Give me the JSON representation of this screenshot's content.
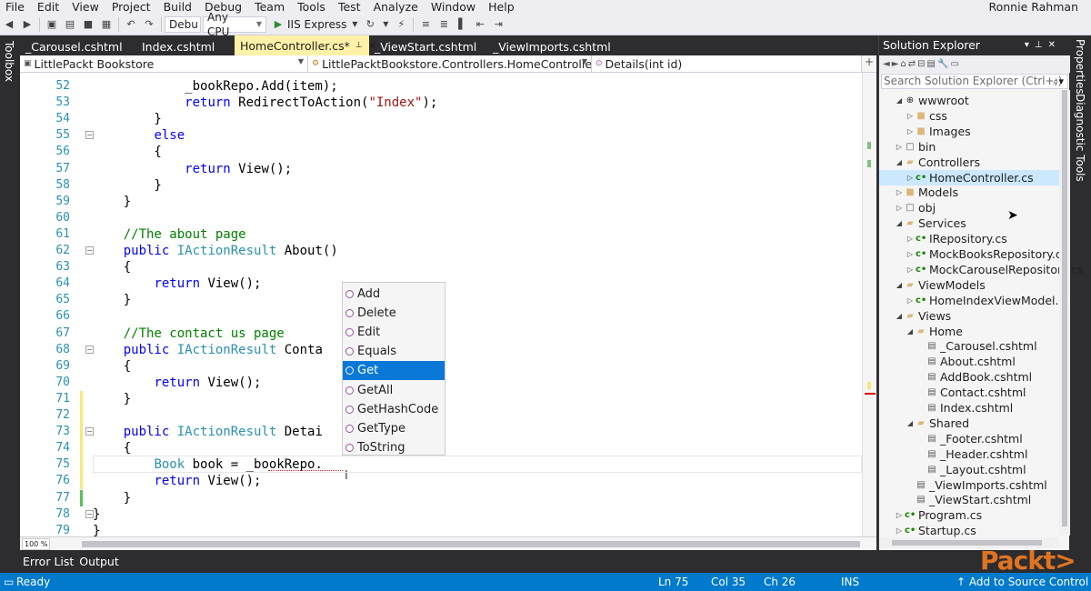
{
  "menu": [
    "File",
    "Edit",
    "View",
    "Project",
    "Build",
    "Debug",
    "Team",
    "Tools",
    "Test",
    "Analyze",
    "Window",
    "Help"
  ],
  "user": "Ronnie Rahman",
  "toolbar": {
    "config": "Debu",
    "platform": "Any CPU",
    "run_target": "IIS Express",
    "icons": [
      "back-icon",
      "forward-icon",
      "new-project-icon",
      "open-icon",
      "save-icon",
      "save-all-icon",
      "undo-icon",
      "redo-icon",
      "play-icon",
      "refresh-icon",
      "browser-link-icon",
      "comment-icon",
      "uncomment-icon",
      "bookmark-icon"
    ]
  },
  "side": {
    "toolbox": "Toolbox",
    "properties": "Properties",
    "diagnostic_tools": "Diagnostic Tools"
  },
  "doc_tabs": [
    {
      "label": "_Carousel.cshtml",
      "active": false
    },
    {
      "label": "Index.cshtml",
      "active": false
    },
    {
      "label": "HomeController.cs*",
      "active": true
    },
    {
      "label": "_ViewStart.cshtml",
      "active": false
    },
    {
      "label": "_ViewImports.cshtml",
      "active": false
    }
  ],
  "navbar": {
    "project": "LittlePackt Bookstore",
    "class": "LittlePacktBookstore.Controllers.HomeController",
    "member": "Details(int id)"
  },
  "code_lines": [
    {
      "n": "52",
      "html": "            _bookRepo.Add(item);"
    },
    {
      "n": "53",
      "html": "            return RedirectToAction(\"Index\");"
    },
    {
      "n": "54",
      "html": "        }"
    },
    {
      "n": "55",
      "html": "        else"
    },
    {
      "n": "56",
      "html": "        {"
    },
    {
      "n": "57",
      "html": "            return View();"
    },
    {
      "n": "58",
      "html": "        }"
    },
    {
      "n": "59",
      "html": "    }"
    },
    {
      "n": "60",
      "html": ""
    },
    {
      "n": "61",
      "html": "    //The about page"
    },
    {
      "n": "62",
      "html": "    public IActionResult About()"
    },
    {
      "n": "63",
      "html": "    {"
    },
    {
      "n": "64",
      "html": "        return View();"
    },
    {
      "n": "65",
      "html": "    }"
    },
    {
      "n": "66",
      "html": ""
    },
    {
      "n": "67",
      "html": "    //The contact us page"
    },
    {
      "n": "68",
      "html": "    public IActionResult Conta"
    },
    {
      "n": "69",
      "html": "    {"
    },
    {
      "n": "70",
      "html": "        return View();"
    },
    {
      "n": "71",
      "html": "    }"
    },
    {
      "n": "72",
      "html": ""
    },
    {
      "n": "73",
      "html": "    public IActionResult Detai"
    },
    {
      "n": "74",
      "html": "    {"
    },
    {
      "n": "75",
      "html": "        Book book = _bookRepo."
    },
    {
      "n": "76",
      "html": "        return View();"
    },
    {
      "n": "77",
      "html": "    }"
    },
    {
      "n": "78",
      "html": "}"
    },
    {
      "n": "79",
      "html": "}"
    }
  ],
  "intellisense": [
    "Add",
    "Delete",
    "Edit",
    "Equals",
    "Get",
    "GetAll",
    "GetHashCode",
    "GetType",
    "ToString"
  ],
  "intellisense_selected": "Get",
  "zoom": "100 %",
  "output_tabs": [
    "Error List",
    "Output"
  ],
  "solution_explorer": {
    "title": "Solution Explorer",
    "search_placeholder": "Search Solution Explorer (Ctrl+;)",
    "nodes": [
      {
        "label": "wwwroot",
        "depth": 0,
        "icon": "globe-icon",
        "arrow": "expanded"
      },
      {
        "label": "css",
        "depth": 1,
        "icon": "folder-icon",
        "arrow": "collapsed"
      },
      {
        "label": "Images",
        "depth": 1,
        "icon": "folder-icon",
        "arrow": "collapsed"
      },
      {
        "label": "bin",
        "depth": 0,
        "icon": "folder-outline-icon",
        "arrow": "collapsed"
      },
      {
        "label": "Controllers",
        "depth": 0,
        "icon": "folder-open-icon",
        "arrow": "expanded"
      },
      {
        "label": "HomeController.cs",
        "depth": 1,
        "icon": "csharp-file-icon",
        "arrow": "collapsed",
        "selected": true
      },
      {
        "label": "Models",
        "depth": 0,
        "icon": "folder-icon",
        "arrow": "collapsed"
      },
      {
        "label": "obj",
        "depth": 0,
        "icon": "folder-outline-icon",
        "arrow": "collapsed"
      },
      {
        "label": "Services",
        "depth": 0,
        "icon": "folder-open-icon",
        "arrow": "expanded"
      },
      {
        "label": "IRepository.cs",
        "depth": 1,
        "icon": "csharp-file-icon",
        "arrow": "collapsed"
      },
      {
        "label": "MockBooksRepository.cs",
        "depth": 1,
        "icon": "csharp-file-icon",
        "arrow": "collapsed"
      },
      {
        "label": "MockCarouselRepository.cs",
        "depth": 1,
        "icon": "csharp-file-icon",
        "arrow": "collapsed"
      },
      {
        "label": "ViewModels",
        "depth": 0,
        "icon": "folder-open-icon",
        "arrow": "expanded"
      },
      {
        "label": "HomeIndexViewModel.cs",
        "depth": 1,
        "icon": "csharp-file-icon",
        "arrow": "collapsed"
      },
      {
        "label": "Views",
        "depth": 0,
        "icon": "folder-open-icon",
        "arrow": "expanded"
      },
      {
        "label": "Home",
        "depth": 1,
        "icon": "folder-open-icon",
        "arrow": "expanded"
      },
      {
        "label": "_Carousel.cshtml",
        "depth": 2,
        "icon": "razor-file-icon",
        "arrow": "none"
      },
      {
        "label": "About.cshtml",
        "depth": 2,
        "icon": "razor-file-icon",
        "arrow": "none"
      },
      {
        "label": "AddBook.cshtml",
        "depth": 2,
        "icon": "razor-file-icon",
        "arrow": "none"
      },
      {
        "label": "Contact.cshtml",
        "depth": 2,
        "icon": "razor-file-icon",
        "arrow": "none"
      },
      {
        "label": "Index.cshtml",
        "depth": 2,
        "icon": "razor-file-icon",
        "arrow": "none"
      },
      {
        "label": "Shared",
        "depth": 1,
        "icon": "folder-open-icon",
        "arrow": "expanded"
      },
      {
        "label": "_Footer.cshtml",
        "depth": 2,
        "icon": "razor-file-icon",
        "arrow": "none"
      },
      {
        "label": "_Header.cshtml",
        "depth": 2,
        "icon": "razor-file-icon",
        "arrow": "none"
      },
      {
        "label": "_Layout.cshtml",
        "depth": 2,
        "icon": "razor-file-icon",
        "arrow": "none"
      },
      {
        "label": "_ViewImports.cshtml",
        "depth": 1,
        "icon": "razor-file-icon",
        "arrow": "none"
      },
      {
        "label": "_ViewStart.cshtml",
        "depth": 1,
        "icon": "razor-file-icon",
        "arrow": "none"
      },
      {
        "label": "Program.cs",
        "depth": 0,
        "icon": "csharp-file-icon",
        "arrow": "collapsed"
      },
      {
        "label": "Startup.cs",
        "depth": 0,
        "icon": "csharp-file-icon",
        "arrow": "collapsed"
      }
    ]
  },
  "status": {
    "ready": "Ready",
    "ln": "Ln 75",
    "col": "Col 35",
    "ch": "Ch 26",
    "ins": "INS",
    "source_control": "Add to Source Control"
  },
  "watermark": "Packt>",
  "colors": {
    "keyword": "#0000ff",
    "type": "#2b91af",
    "comment": "#008000",
    "string": "#a31515",
    "status_bar": "#007acc",
    "active_tab": "#fff1a8",
    "selection": "#0a78d7"
  }
}
